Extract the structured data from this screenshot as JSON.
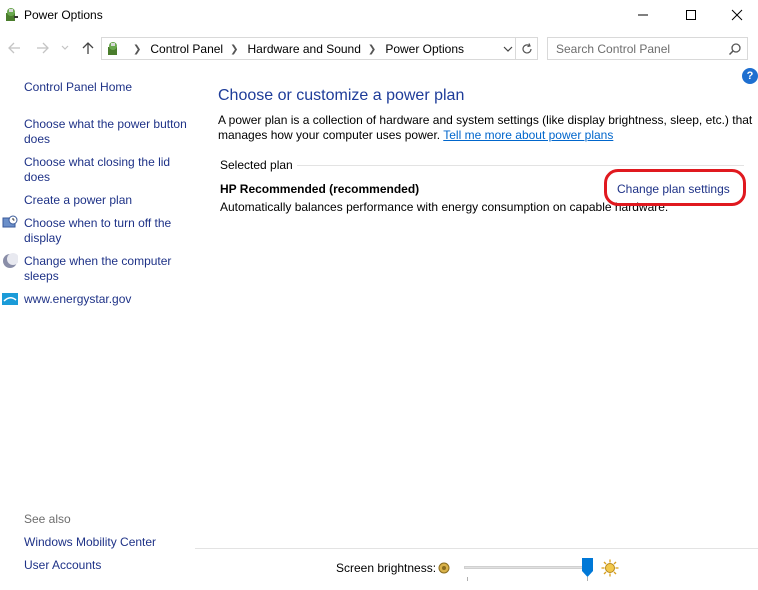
{
  "window": {
    "title": "Power Options"
  },
  "address": {
    "crumbs": [
      "Control Panel",
      "Hardware and Sound",
      "Power Options"
    ],
    "search_placeholder": "Search Control Panel"
  },
  "help": {
    "label": "?"
  },
  "sidebar": {
    "home": "Control Panel Home",
    "items": [
      {
        "label": "Choose what the power button does",
        "icon": "none"
      },
      {
        "label": "Choose what closing the lid does",
        "icon": "none"
      },
      {
        "label": "Create a power plan",
        "icon": "none"
      },
      {
        "label": "Choose when to turn off the display",
        "icon": "display-clock-icon"
      },
      {
        "label": "Change when the computer sleeps",
        "icon": "moon-icon"
      },
      {
        "label": "www.energystar.gov",
        "icon": "energystar-icon"
      }
    ],
    "see_also": "See also",
    "see_also_links": [
      "Windows Mobility Center",
      "User Accounts"
    ]
  },
  "main": {
    "title": "Choose or customize a power plan",
    "description": "A power plan is a collection of hardware and system settings (like display brightness, sleep, etc.) that manages how your computer uses power.",
    "learn_more": "Tell me more about power plans",
    "selected_label": "Selected plan",
    "plan_name": "HP Recommended (recommended)",
    "plan_description": "Automatically balances performance with energy consumption on capable hardware.",
    "change_link": "Change plan settings"
  },
  "footer": {
    "brightness_label": "Screen brightness:",
    "brightness_level_percent": 100
  },
  "colors": {
    "link": "#1e3287",
    "title": "#1e3c99",
    "highlight": "#e0191f"
  }
}
